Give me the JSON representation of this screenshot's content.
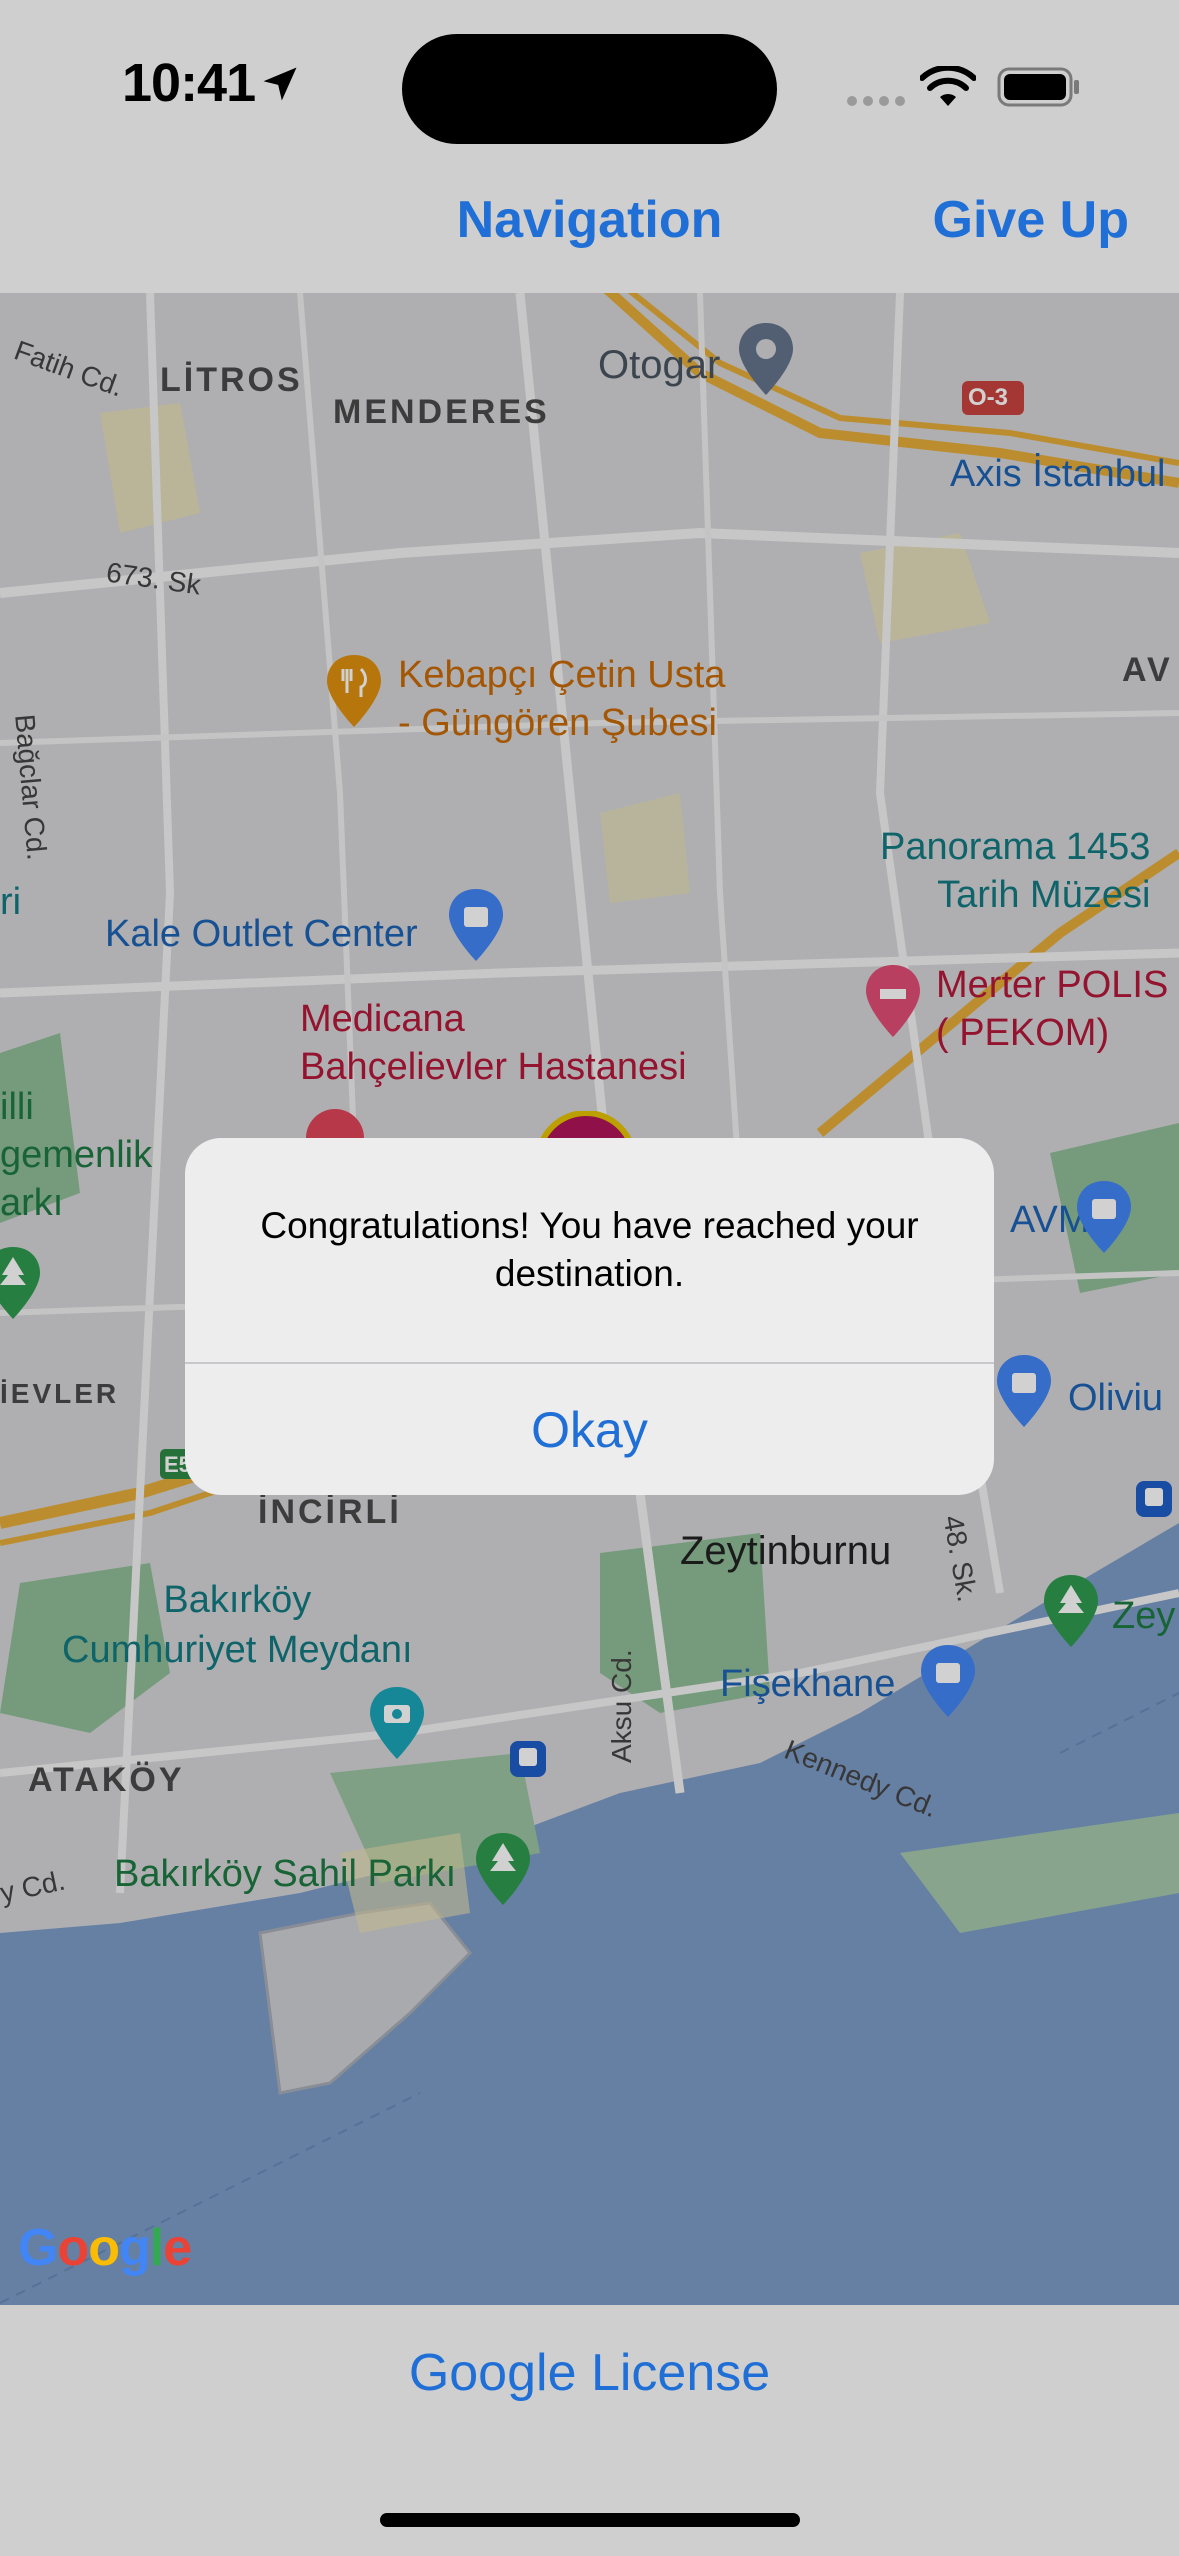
{
  "status_bar": {
    "time": "10:41",
    "icons": [
      "location-arrow-icon",
      "cellular-signal-icon",
      "wifi-icon",
      "battery-icon"
    ]
  },
  "nav": {
    "title": "Navigation",
    "give_up_label": "Give Up"
  },
  "map": {
    "districts": [
      "LİTROS",
      "MENDERES",
      "AV",
      "İEVLER",
      "İNCİRLİ",
      "ATAKÖY"
    ],
    "streets": [
      "Fatih Cd.",
      "673. Sk",
      "Bağclar Cd.",
      "48. Sk.",
      "Aksu Cd.",
      "Kennedy Cd.",
      "y Cd.",
      "O-3",
      "E5"
    ],
    "places": {
      "otogar": "Otogar",
      "axis": "Axis İstanbul",
      "kebapci": "Kebapçı Çetin Usta\n- Güngören Şubesi",
      "panorama": "Panorama 1453\nTarih Müzesi",
      "kale_outlet": "Kale Outlet Center",
      "merter": "Merter POLIS\n( PEKOM)",
      "medicana": "Medicana\nBahçelievler Hastanesi",
      "left_ri": "ri",
      "left_milli": "illi\ngemenlik\narkı",
      "avm": "AVM",
      "olivium": "Oliviu",
      "zeytinburnu": "Zeytinburnu",
      "bakirkoy_meydan": "Bakırköy\nCumhuriyet Meydanı",
      "fisekhane": "Fişekhane",
      "zey": "Zey",
      "sahil": "Bakırköy Sahil Parkı"
    },
    "logo": "Google"
  },
  "alert": {
    "message": "Congratulations! You have reached your destination.",
    "button": "Okay"
  },
  "footer": {
    "license_label": "Google License"
  },
  "colors": {
    "accent": "#1f6fd6",
    "water": "#7d9dc9",
    "park": "#86b58f",
    "highway": "#e4ad3a"
  }
}
